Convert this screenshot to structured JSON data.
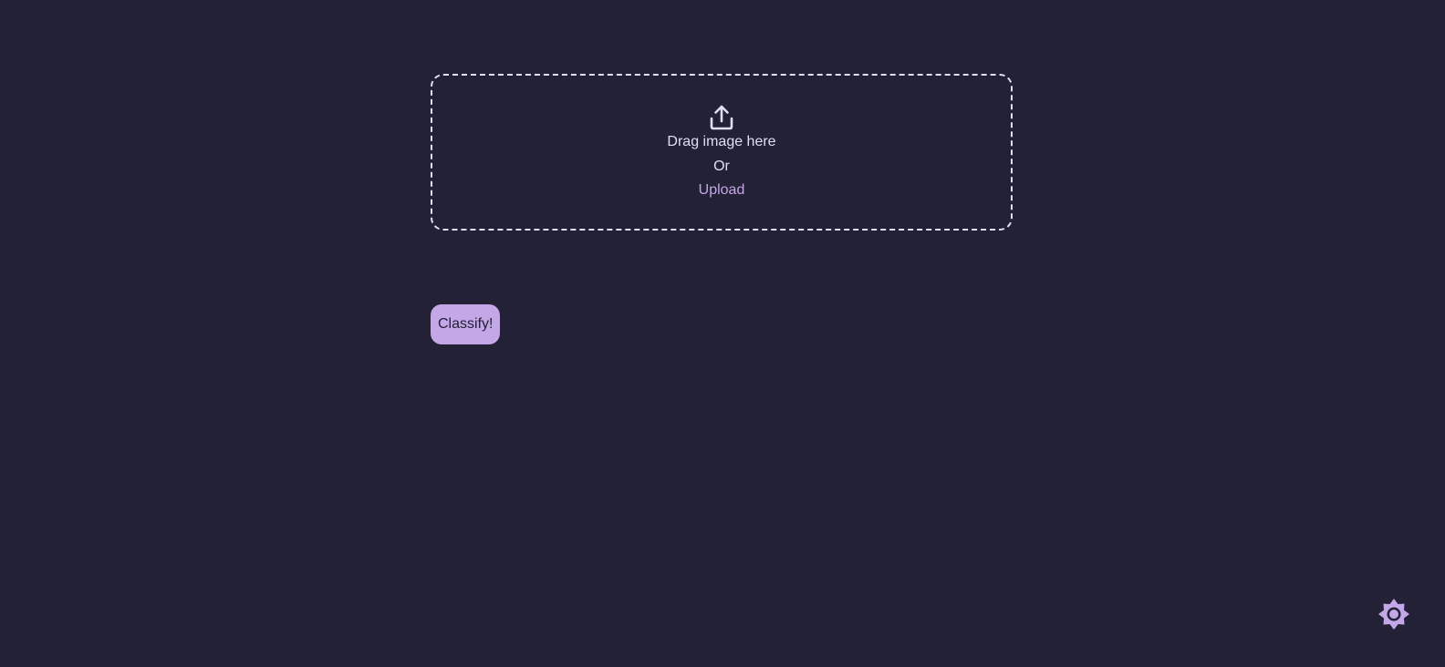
{
  "dropzone": {
    "icon": "upload-icon",
    "drag_text": "Drag image here",
    "or_text": "Or",
    "upload_link": "Upload"
  },
  "actions": {
    "classify_label": "Classify!"
  },
  "theme_toggle": {
    "icon": "sun-gear-icon"
  },
  "colors": {
    "background": "#232136",
    "foreground": "#e0def4",
    "accent": "#c4a7e7"
  }
}
